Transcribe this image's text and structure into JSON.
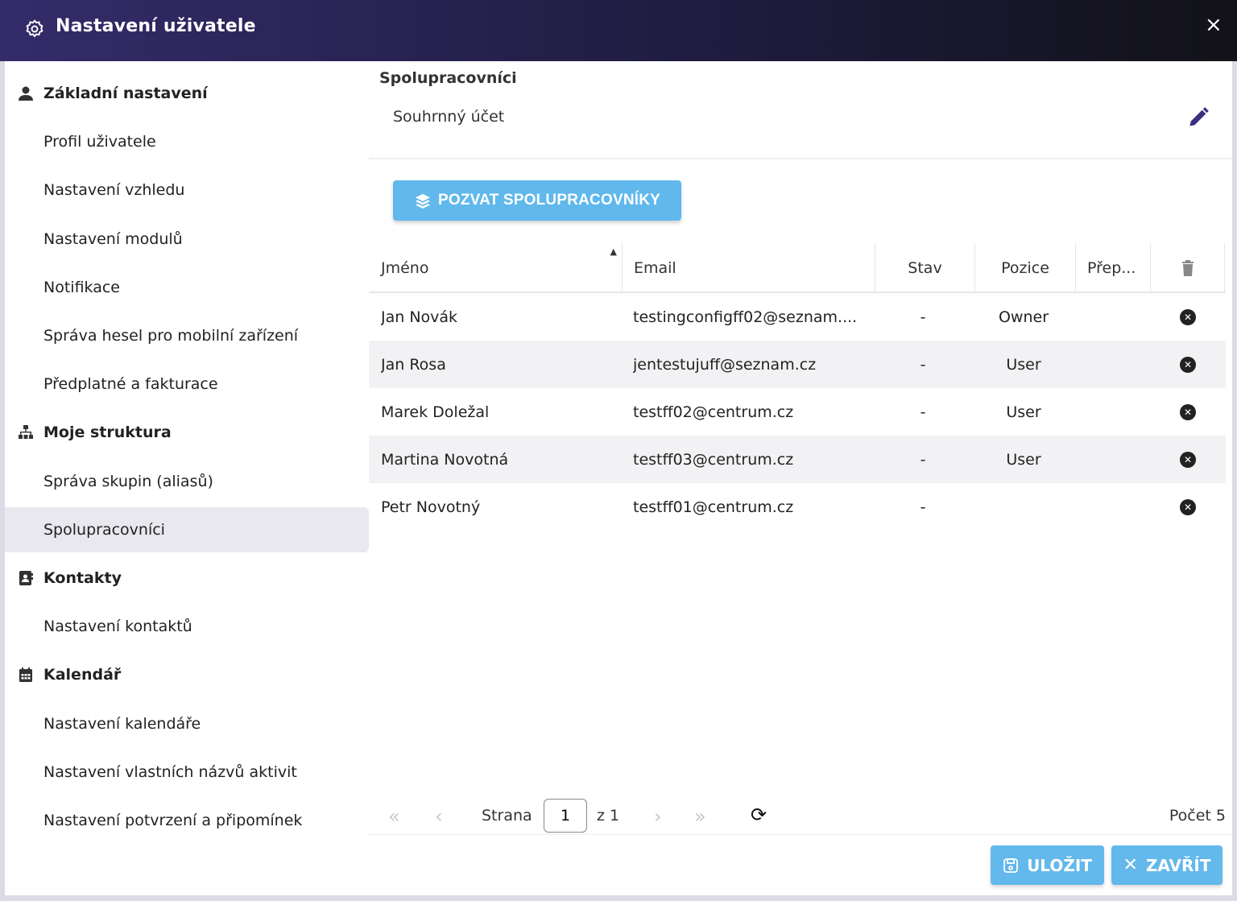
{
  "header": {
    "title": "Nastavení uživatele",
    "close_label": "×"
  },
  "sidebar": {
    "sections": [
      {
        "label": "Základní nastavení",
        "icon": "user-icon",
        "items": [
          "Profil uživatele",
          "Nastavení vzhledu",
          "Nastavení modulů",
          "Notifikace",
          "Správa hesel pro mobilní zařízení",
          "Předplatné a fakturace"
        ]
      },
      {
        "label": "Moje struktura",
        "icon": "sitemap-icon",
        "items": [
          "Správa skupin (aliasů)",
          "Spolupracovníci"
        ]
      },
      {
        "label": "Kontakty",
        "icon": "address-book-icon",
        "items": [
          "Nastavení kontaktů"
        ]
      },
      {
        "label": "Kalendář",
        "icon": "calendar-icon",
        "items": [
          "Nastavení kalendáře",
          "Nastavení vlastních názvů aktivit",
          "Nastavení potvrzení a připomínek"
        ]
      }
    ],
    "selected": "Spolupracovníci"
  },
  "main": {
    "title": "Spolupracovníci",
    "subtitle": "Souhrnný účet",
    "invite_label": "POZVAT SPOLUPRACOVNÍKY",
    "columns": [
      "Jméno",
      "Email",
      "Stav",
      "Pozice",
      "Přep..."
    ],
    "rows": [
      {
        "name": "Jan Novák",
        "email": "testingconfigff02@seznam....",
        "status": "-",
        "position": "Owner"
      },
      {
        "name": "Jan Rosa",
        "email": "jentestujuff@seznam.cz",
        "status": "-",
        "position": "User"
      },
      {
        "name": "Marek Doležal",
        "email": "testff02@centrum.cz",
        "status": "-",
        "position": "User"
      },
      {
        "name": "Martina Novotná",
        "email": "testff03@centrum.cz",
        "status": "-",
        "position": "User"
      },
      {
        "name": "Petr Novotný",
        "email": "testff01@centrum.cz",
        "status": "-",
        "position": ""
      }
    ],
    "pager": {
      "page_label": "Strana",
      "page": "1",
      "of_label": "z 1",
      "count_label": "Počet 5"
    }
  },
  "footer": {
    "save_label": "ULOŽIT",
    "close_label": "ZAVŘÍT"
  },
  "colors": {
    "accent": "#60b8ec",
    "header": "#342c6a"
  }
}
